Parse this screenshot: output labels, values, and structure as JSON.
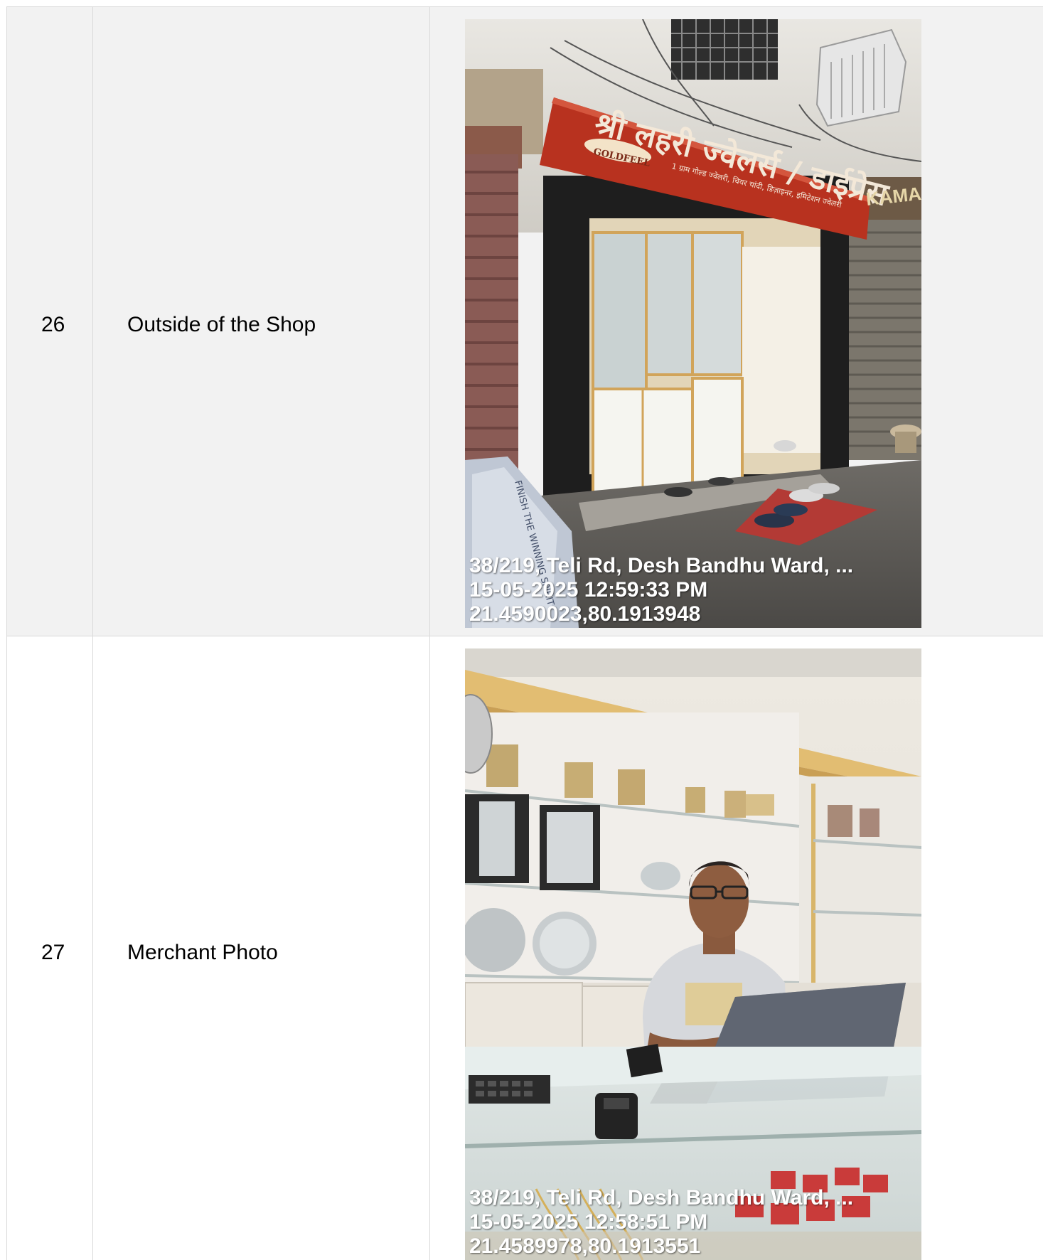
{
  "rows": [
    {
      "number": "26",
      "label": "Outside of the Shop",
      "photo": {
        "sign_text": "श्री लहरी ज्वेलर्स / डाईप्रेस",
        "sign_badge": "GOLDFEEL",
        "sign_subtext": "1 ग्राम गोल्ड ज्वेलरी, चियर चांदी, डिज़ाइनर, इमिटेशन ज्वेलरी",
        "neighbor_sign": "KAMAL",
        "bag_text": "FINISH THE WINNING SPIRIT",
        "address": "38/219, Teli Rd, Desh Bandhu Ward, ...",
        "datetime": "15-05-2025 12:59:33 PM",
        "coords": "21.4590023,80.1913948"
      }
    },
    {
      "number": "27",
      "label": "Merchant Photo",
      "photo": {
        "address": "38/219, Teli Rd, Desh Bandhu Ward, ...",
        "datetime": "15-05-2025 12:58:51 PM",
        "coords": "21.4589978,80.1913551"
      }
    }
  ],
  "colors": {
    "row_alt_bg": "#f2f2f2",
    "row_bg": "#ffffff",
    "border": "#d9d9d9",
    "sign_red": "#b8321f"
  }
}
